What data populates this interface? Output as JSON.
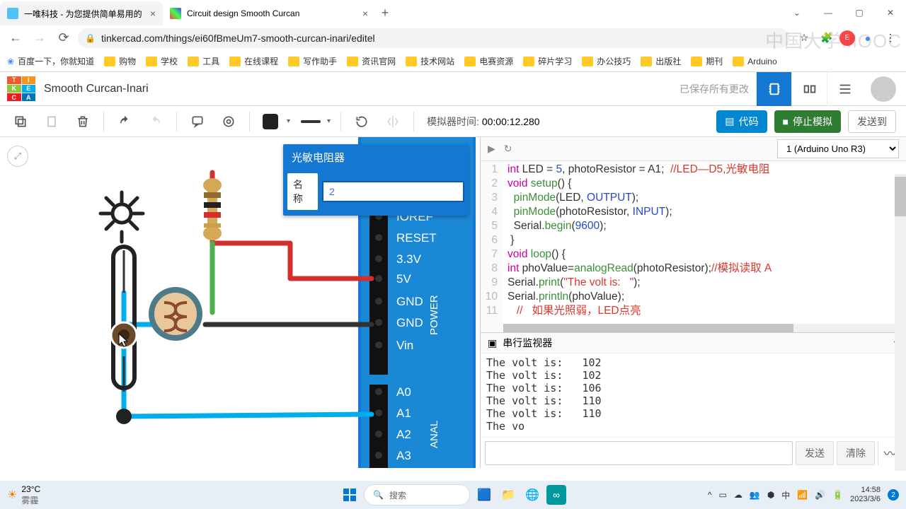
{
  "browser": {
    "tabs": [
      {
        "title": "一唯科技 - 为您提供简单易用的",
        "favicon": "#4fc3f7"
      },
      {
        "title": "Circuit design Smooth Curcan",
        "favicon": "multi"
      }
    ],
    "url": "tinkercad.com/things/ei60fBmeUm7-smooth-curcan-inari/editel",
    "bookmarks": [
      "百度一下，你就知道",
      "购物",
      "学校",
      "工具",
      "在线课程",
      "写作助手",
      "资讯官网",
      "技术网站",
      "电赛资源",
      "碎片学习",
      "办公技巧",
      "出版社",
      "期刊",
      "Arduino"
    ],
    "watermark": "中国大学MOOC"
  },
  "tinkercad": {
    "project_title": "Smooth Curcan-Inari",
    "saved_text": "已保存所有更改",
    "sim_label": "模拟器时间: ",
    "sim_time": "00:00:12.280",
    "btn_code": "代码",
    "btn_stop": "停止模拟",
    "btn_send": "发送到"
  },
  "popup": {
    "title": "光敏电阻器",
    "label": "名称",
    "value": "2"
  },
  "code": {
    "board_selector": "1 (Arduino Uno R3)",
    "serial_title": "串行监视器",
    "serial_lines": "The volt is:   102\nThe volt is:   102\nThe volt is:   106\nThe volt is:   110\nThe volt is:   110\nThe vo",
    "btn_send": "发送",
    "btn_clear": "清除"
  },
  "taskbar": {
    "temp": "23°C",
    "cond": "雾霾",
    "search": "搜索",
    "ime": "中",
    "time": "14:58",
    "date": "2023/3/6"
  }
}
